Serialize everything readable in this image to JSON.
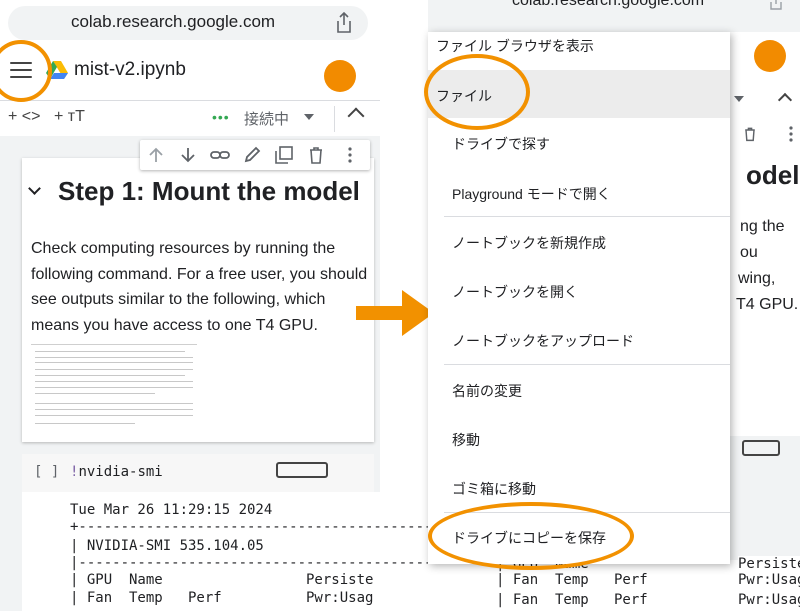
{
  "left": {
    "url": "colab.research.google.com",
    "notebook_title": "mist-v2.ipynb",
    "toolbar": {
      "add_code": "+ <>",
      "add_text": "+ ᴛT",
      "status_dots": "•••",
      "status": "接続中"
    },
    "cell": {
      "title": "Step 1: Mount the model",
      "paragraph": "Check computing resources by running the following command. For a free user, you should see outputs similar to the following, which means you have access to one T4 GPU."
    },
    "code_cell": {
      "bracket": "[ ]",
      "bang": "!",
      "command": "nvidia-smi"
    },
    "output": {
      "lines": [
        "Tue Mar 26 11:29:15 2024",
        "+-------------------------------------------",
        "| NVIDIA-SMI 535.104.05",
        "|-------------------------------------------",
        "| GPU  Name                 Persiste",
        "| Fan  Temp   Perf          Pwr:Usag"
      ]
    }
  },
  "right": {
    "url": "colab.research.google.com",
    "bg_title_fragment": "odel",
    "bg_para_lines": [
      "ng the",
      "ou",
      "wing,",
      "T4 GPU."
    ],
    "bg_output_lines": [
      "| GPU  Name",
      "| Fan  Temp   Perf",
      "| Fan  Temp   Perf"
    ],
    "bg_output_right": [
      "Persiste",
      "Pwr:Usag",
      "Pwr:Usag"
    ],
    "menu": {
      "header": "ファイル ブラウザを表示",
      "selected": "ファイル",
      "items": [
        "ドライブで探す",
        "Playground モードで開く",
        "ノートブックを新規作成",
        "ノートブックを開く",
        "ノートブックをアップロード",
        "名前の変更",
        "移動",
        "ゴミ箱に移動",
        "ドライブにコピーを保存"
      ]
    }
  },
  "colors": {
    "accent_orange": "#f29100",
    "avatar": "#f28b00",
    "status_green": "#34a853"
  },
  "icons": [
    "menu-icon",
    "share-icon",
    "drive-logo",
    "arrow-up-icon",
    "arrow-down-icon",
    "link-icon",
    "pencil-icon",
    "mirror-cell-icon",
    "trash-icon",
    "more-vert-icon",
    "keyboard-icon",
    "chevron-down-icon",
    "chevron-up-icon"
  ]
}
